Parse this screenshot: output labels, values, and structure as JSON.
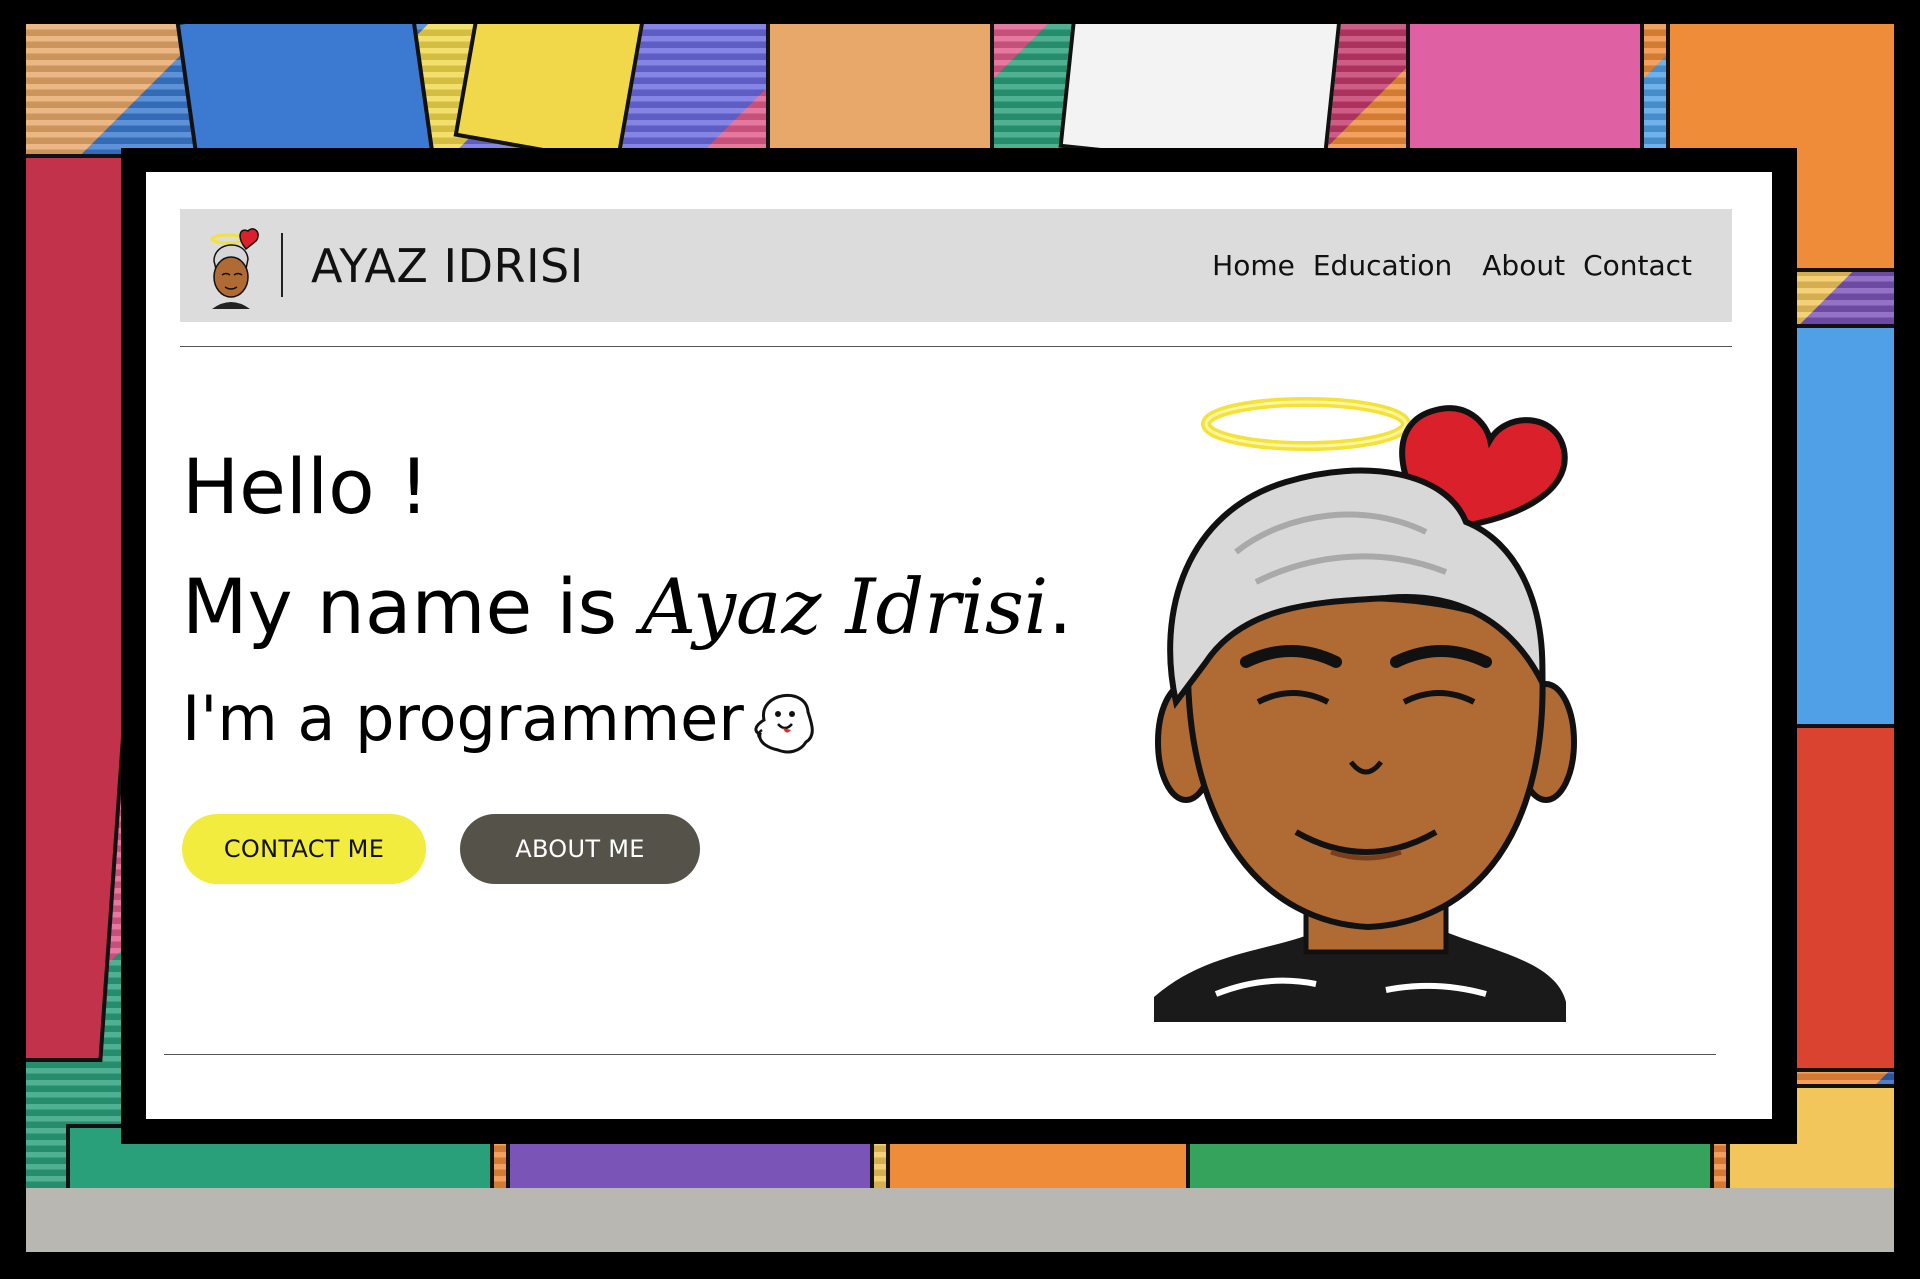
{
  "nav": {
    "brand": "AYAZ IDRISI",
    "links": [
      "Home",
      "Education",
      "About",
      "Contact"
    ]
  },
  "hero": {
    "greeting": "Hello !",
    "intro_prefix": "My name is ",
    "name": "Ayaz Idrisi",
    "intro_suffix": ".",
    "role": "I'm a programmer"
  },
  "buttons": {
    "contact": "CONTACT ME",
    "about": "ABOUT ME"
  },
  "colors": {
    "contact_button": "#f2ec3e",
    "about_button": "#545249",
    "navbar": "#dcdcdc"
  },
  "icons": [
    "avatar-logo-icon",
    "ghost-emoji-icon",
    "avatar-illustration"
  ]
}
